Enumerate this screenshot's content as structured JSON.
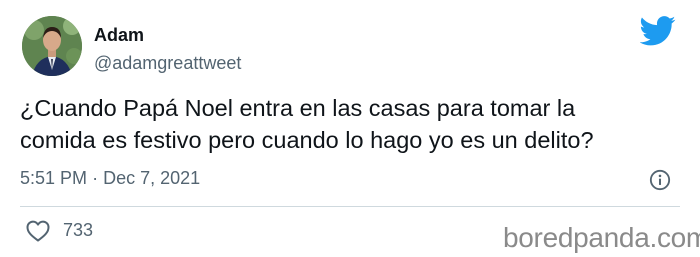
{
  "tweet": {
    "author_name": "Adam",
    "author_handle": "@adamgreattweet",
    "text": "¿Cuando Papá Noel entra en las casas para tomar la\ncomida es festivo pero cuando lo hago yo es un delito?",
    "time": "5:51 PM",
    "separator": "·",
    "date": "Dec 7, 2021",
    "likes": "733"
  },
  "icons": {
    "brand": "twitter-bird-icon",
    "info": "info-icon",
    "like": "heart-icon"
  },
  "colors": {
    "twitter_blue": "#1d9bf0",
    "secondary_text": "#536471",
    "primary_text": "#0f1419"
  },
  "watermark": "boredpanda.com"
}
